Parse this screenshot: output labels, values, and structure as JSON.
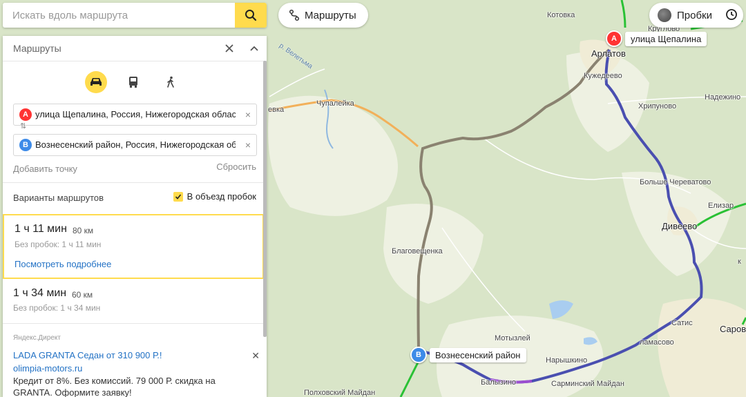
{
  "search": {
    "placeholder": "Искать вдоль маршрута"
  },
  "top_buttons": {
    "routes_label": "Маршруты",
    "traffic_label": "Пробки"
  },
  "panel": {
    "title": "Маршруты",
    "transport_modes": [
      "car-icon",
      "bus-icon",
      "walk-icon"
    ],
    "point_a": {
      "letter": "A",
      "value": "улица Щепалина, Россия, Нижегородская область"
    },
    "point_b": {
      "letter": "B",
      "value": "Вознесенский район, Россия, Нижегородская область"
    },
    "add_point": "Добавить точку",
    "reset": "Сбросить",
    "options_label": "Варианты маршрутов",
    "avoid_traffic_label": "В объезд пробок",
    "avoid_traffic_checked": true,
    "routes": [
      {
        "time": "1 ч 11 мин",
        "distance": "80 км",
        "no_traffic": "Без пробок: 1 ч 11 мин",
        "details_link": "Посмотреть подробнее",
        "selected": true
      },
      {
        "time": "1 ч 34 мин",
        "distance": "60 км",
        "no_traffic": "Без пробок: 1 ч 34 мин",
        "selected": false
      }
    ],
    "ad": {
      "label": "Яндекс.Директ",
      "title": "LADA GRANTA Седан от 310 900 Р.!",
      "domain": "olimpia-motors.ru",
      "text": "Кредит от 8%. Без комиссий. 79 000 Р. скидка на GRANTA. Оформите заявку!"
    }
  },
  "map": {
    "marker_a_label": "улица Щепалина",
    "marker_b_label": "Вознесенский район",
    "places": {
      "kotovka": "Котовка",
      "kruglovo": "Круглово",
      "ardatov": "Арлатов",
      "kuzhentseevo": "Кужедеево",
      "nadezhino": "Надежино",
      "khripunovo": "Хрипуново",
      "chupaleyka": "Чупалейка",
      "evka": "евка",
      "bolshoe": "Больше Череватово",
      "elizar": "Елизар",
      "diveevo": "Дивеево",
      "blagoveshchenka": "Благовещенка",
      "satis": "Сатис",
      "sarov": "Саров",
      "motyzley": "Мотызлей",
      "lamasovo": "ламасово",
      "narkhazhino": "Нарышкино",
      "balyzino": "Балызино",
      "sarminsky": "Сарминский Майдан",
      "polkhovsky": "Полховский Майдан",
      "r": "к"
    },
    "river_label": "р. Велетьма"
  },
  "colors": {
    "accent": "#ffdb4d",
    "link": "#2372c5",
    "route_main": "#4a4fb0",
    "route_alt": "#8a8270"
  }
}
